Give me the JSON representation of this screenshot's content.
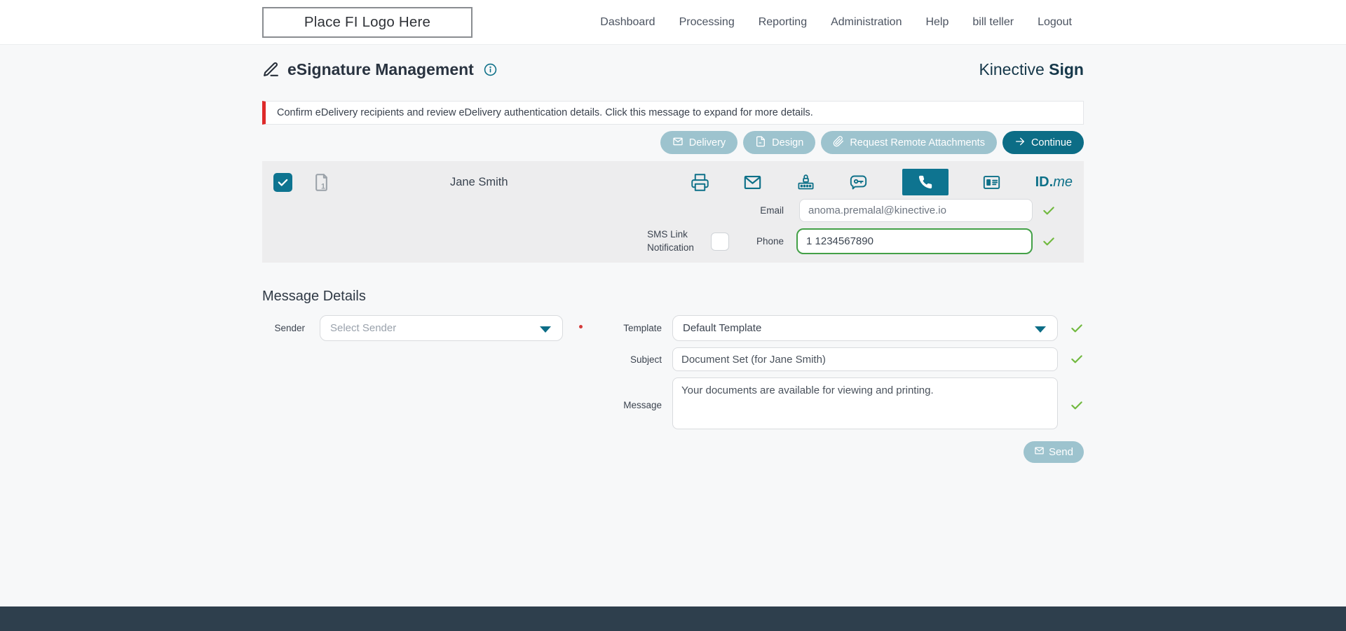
{
  "nav": {
    "logo_text": "Place FI Logo Here",
    "items": [
      {
        "label": "Dashboard"
      },
      {
        "label": "Processing"
      },
      {
        "label": "Reporting"
      },
      {
        "label": "Administration"
      },
      {
        "label": "Help"
      },
      {
        "label": "bill teller"
      },
      {
        "label": "Logout"
      }
    ]
  },
  "header": {
    "title": "eSignature Management",
    "brand": {
      "name": "Kinective",
      "product": "Sign"
    }
  },
  "alert": {
    "text": "Confirm eDelivery recipients and review eDelivery authentication details. Click this message to expand for more details."
  },
  "toolbar": {
    "delivery_label": "Delivery",
    "design_label": "Design",
    "request_remote_attachments_label": "Request Remote Attachments",
    "continue_label": "Continue"
  },
  "recipient": {
    "name": "Jane Smith",
    "document_count": "1",
    "selected": true,
    "idme": {
      "id_part": "ID.",
      "me_part": "me"
    },
    "email": {
      "label": "Email",
      "value": "anoma.premalal@kinective.io"
    },
    "sms": {
      "label_line1": "SMS Link",
      "label_line2": "Notification",
      "checked": false
    },
    "phone": {
      "label": "Phone",
      "value": "1 1234567890"
    }
  },
  "message_details": {
    "heading": "Message Details",
    "sender": {
      "label": "Sender",
      "placeholder": "Select Sender"
    },
    "template": {
      "label": "Template",
      "value": "Default Template"
    },
    "subject": {
      "label": "Subject",
      "value": "Document Set (for Jane Smith)"
    },
    "message": {
      "label": "Message",
      "value": "Your documents are available for viewing and printing."
    },
    "send_label": "Send"
  },
  "colors": {
    "primary_teal": "#0d7088",
    "muted_button": "#9dc3ce",
    "alert_accent": "#de2a2a",
    "valid_green": "#71b93f",
    "idme_blue": "#14459c",
    "brand_text": "#16384a",
    "footer": "#2e3f4d"
  }
}
